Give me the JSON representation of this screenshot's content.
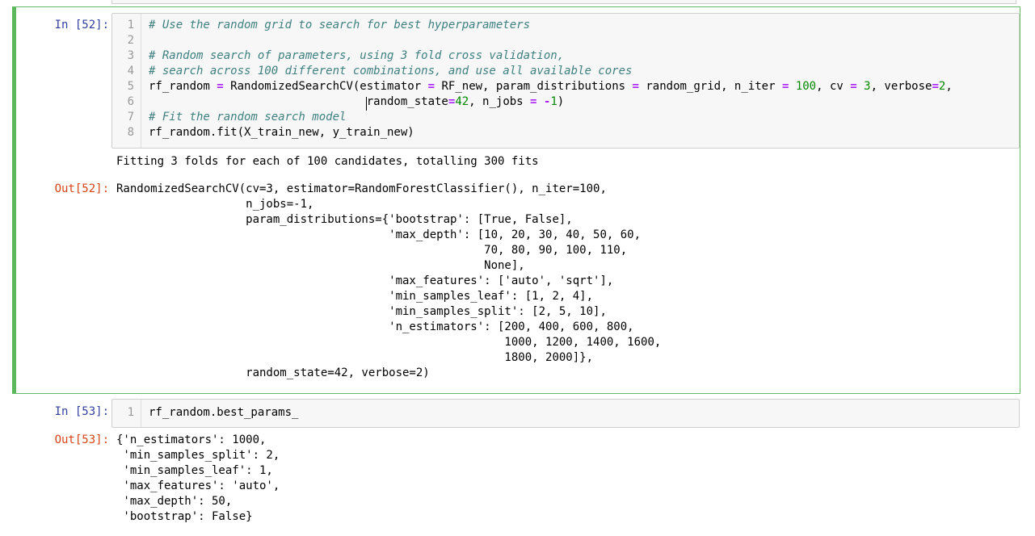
{
  "cells": [
    {
      "in_prompt": "In [52]:",
      "code_lines": [
        {
          "num": "1",
          "tokens": [
            {
              "t": "# Use the random grid to search for best hyperparameters",
              "k": "comment"
            }
          ]
        },
        {
          "num": "2",
          "tokens": []
        },
        {
          "num": "3",
          "tokens": [
            {
              "t": "# Random search of parameters, using 3 fold cross validation,",
              "k": "comment"
            }
          ]
        },
        {
          "num": "4",
          "tokens": [
            {
              "t": "# search across 100 different combinations, and use all available cores",
              "k": "comment"
            }
          ]
        },
        {
          "num": "5",
          "tokens": [
            {
              "t": "rf_random ",
              "k": "plain"
            },
            {
              "t": "=",
              "k": "op"
            },
            {
              "t": " RandomizedSearchCV(estimator ",
              "k": "plain"
            },
            {
              "t": "=",
              "k": "op"
            },
            {
              "t": " RF_new, param_distributions ",
              "k": "plain"
            },
            {
              "t": "=",
              "k": "op"
            },
            {
              "t": " random_grid, n_iter ",
              "k": "plain"
            },
            {
              "t": "=",
              "k": "op"
            },
            {
              "t": " ",
              "k": "plain"
            },
            {
              "t": "100",
              "k": "num"
            },
            {
              "t": ", cv ",
              "k": "plain"
            },
            {
              "t": "=",
              "k": "op"
            },
            {
              "t": " ",
              "k": "plain"
            },
            {
              "t": "3",
              "k": "num"
            },
            {
              "t": ", verbose",
              "k": "plain"
            },
            {
              "t": "=",
              "k": "op"
            },
            {
              "t": "2",
              "k": "num"
            },
            {
              "t": ",",
              "k": "plain"
            }
          ]
        },
        {
          "num": "6",
          "tokens": [
            {
              "t": "                                random_state",
              "k": "plain"
            },
            {
              "t": "=",
              "k": "op"
            },
            {
              "t": "42",
              "k": "num"
            },
            {
              "t": ", n_jobs ",
              "k": "plain"
            },
            {
              "t": "=",
              "k": "op"
            },
            {
              "t": " ",
              "k": "plain"
            },
            {
              "t": "-",
              "k": "op"
            },
            {
              "t": "1",
              "k": "num"
            },
            {
              "t": ")",
              "k": "plain"
            }
          ]
        },
        {
          "num": "7",
          "tokens": [
            {
              "t": "# Fit the random search model",
              "k": "comment"
            }
          ]
        },
        {
          "num": "8",
          "tokens": [
            {
              "t": "rf_random.fit(X_train_new, y_train_new)",
              "k": "plain"
            }
          ]
        }
      ],
      "stream_output": "Fitting 3 folds for each of 100 candidates, totalling 300 fits",
      "out_prompt": "Out[52]:",
      "out_lines": [
        "RandomizedSearchCV(cv=3, estimator=RandomForestClassifier(), n_iter=100,",
        "                   n_jobs=-1,",
        "                   param_distributions={'bootstrap': [True, False],",
        "                                        'max_depth': [10, 20, 30, 40, 50, 60,",
        "                                                      70, 80, 90, 100, 110,",
        "                                                      None],",
        "                                        'max_features': ['auto', 'sqrt'],",
        "                                        'min_samples_leaf': [1, 2, 4],",
        "                                        'min_samples_split': [2, 5, 10],",
        "                                        'n_estimators': [200, 400, 600, 800,",
        "                                                         1000, 1200, 1400, 1600,",
        "                                                         1800, 2000]},",
        "                   random_state=42, verbose=2)"
      ]
    },
    {
      "in_prompt": "In [53]:",
      "code_lines": [
        {
          "num": "1",
          "tokens": [
            {
              "t": "rf_random.best_params_",
              "k": "plain"
            }
          ]
        }
      ],
      "out_prompt": "Out[53]:",
      "out_lines": [
        "{'n_estimators': 1000,",
        " 'min_samples_split': 2,",
        " 'min_samples_leaf': 1,",
        " 'max_features': 'auto',",
        " 'max_depth': 50,",
        " 'bootstrap': False}"
      ]
    }
  ],
  "colors": {
    "selected_border": "#5cb85c",
    "in_prompt": "#303f9f",
    "out_prompt": "#d84315",
    "comment": "#408080",
    "operator": "#aa22ff",
    "number": "#008800"
  }
}
